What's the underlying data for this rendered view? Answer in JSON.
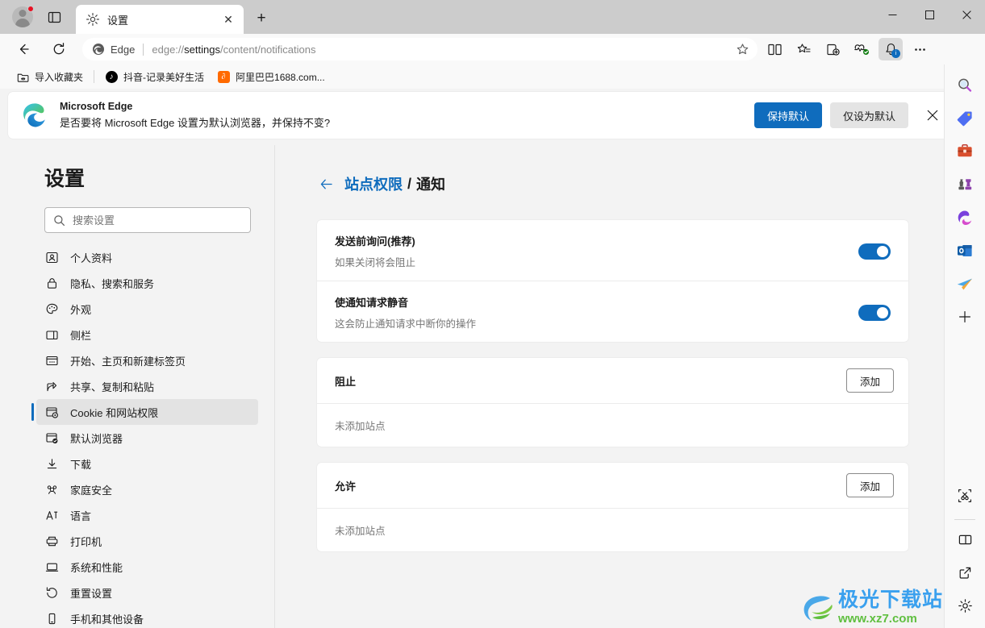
{
  "window": {
    "minimize_label": "–",
    "maximize_label": "□",
    "close_label": "✕"
  },
  "tabs": [
    {
      "title": "设置",
      "icon": "gear-icon",
      "close_label": "✕"
    }
  ],
  "newtab_label": "+",
  "address": {
    "brand_label": "Edge",
    "url_prefix": "edge://",
    "url_emphasis": "settings",
    "url_suffix": "/content/notifications"
  },
  "bookmarks": [
    {
      "label": "导入收藏夹",
      "icon": "import-favorites-icon"
    },
    {
      "label": "抖音-记录美好生活",
      "icon": "douyin-icon",
      "glyph": "♪"
    },
    {
      "label": "阿里巴巴1688.com...",
      "icon": "alibaba-icon",
      "glyph": "∂"
    }
  ],
  "banner": {
    "title": "Microsoft Edge",
    "message": "是否要将 Microsoft Edge 设置为默认浏览器，并保持不变?",
    "primary_label": "保持默认",
    "secondary_label": "仅设为默认",
    "close_label": "✕"
  },
  "sidebar": {
    "title": "设置",
    "search_placeholder": "搜索设置",
    "items": [
      {
        "label": "个人资料",
        "icon": "profile-icon",
        "selected": false
      },
      {
        "label": "隐私、搜索和服务",
        "icon": "lock-icon",
        "selected": false
      },
      {
        "label": "外观",
        "icon": "palette-icon",
        "selected": false
      },
      {
        "label": "侧栏",
        "icon": "sidebar-icon",
        "selected": false
      },
      {
        "label": "开始、主页和新建标签页",
        "icon": "startpage-icon",
        "selected": false
      },
      {
        "label": "共享、复制和粘贴",
        "icon": "share-icon",
        "selected": false
      },
      {
        "label": "Cookie 和网站权限",
        "icon": "cookie-permissions-icon",
        "selected": true
      },
      {
        "label": "默认浏览器",
        "icon": "default-browser-icon",
        "selected": false
      },
      {
        "label": "下载",
        "icon": "download-icon",
        "selected": false
      },
      {
        "label": "家庭安全",
        "icon": "family-safety-icon",
        "selected": false
      },
      {
        "label": "语言",
        "icon": "language-icon",
        "selected": false
      },
      {
        "label": "打印机",
        "icon": "printer-icon",
        "selected": false
      },
      {
        "label": "系统和性能",
        "icon": "system-performance-icon",
        "selected": false
      },
      {
        "label": "重置设置",
        "icon": "reset-settings-icon",
        "selected": false
      },
      {
        "label": "手机和其他设备",
        "icon": "phone-devices-icon",
        "selected": false
      }
    ]
  },
  "main": {
    "breadcrumb_link": "站点权限",
    "breadcrumb_separator": "/",
    "breadcrumb_current": "通知",
    "toggles": [
      {
        "title": "发送前询问(推荐)",
        "subtitle": "如果关闭将会阻止",
        "state": "on"
      },
      {
        "title": "使通知请求静音",
        "subtitle": "这会防止通知请求中断你的操作",
        "state": "on"
      }
    ],
    "sections": [
      {
        "title": "阻止",
        "add_label": "添加",
        "empty_text": "未添加站点"
      },
      {
        "title": "允许",
        "add_label": "添加",
        "empty_text": "未添加站点"
      }
    ]
  },
  "edgebar": {
    "items": [
      {
        "icon": "search-discover-icon"
      },
      {
        "icon": "shopping-tag-icon"
      },
      {
        "icon": "tools-briefcase-icon"
      },
      {
        "icon": "games-icon"
      },
      {
        "icon": "microsoft365-icon"
      },
      {
        "icon": "outlook-icon"
      },
      {
        "icon": "telegram-send-icon"
      }
    ],
    "add_label": "+",
    "bottom_items": [
      {
        "icon": "screenshot-snip-icon"
      },
      {
        "icon": "split-pane-icon"
      },
      {
        "icon": "open-external-icon"
      },
      {
        "icon": "customize-gear-icon"
      }
    ]
  },
  "watermark": {
    "main": "极光下载站",
    "sub": "www.xz7.com"
  },
  "colors": {
    "accent": "#0f6cbd",
    "toggle_on": "#0f6cbd",
    "titlebar": "#cccccc",
    "chrome": "#f9f9f9",
    "page_bg": "#f3f3f3"
  }
}
